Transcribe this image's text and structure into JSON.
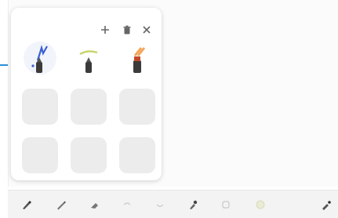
{
  "pen_panel": {
    "add_button_icon": "plus-icon",
    "delete_button_icon": "trash-icon",
    "close_button_icon": "close-icon",
    "favorite_pens": [
      {
        "type": "fountain-pen",
        "stroke_color": "#3b5fd6",
        "selected": true
      },
      {
        "type": "marker",
        "stroke_color": "#c7d36a",
        "selected": false
      },
      {
        "type": "highlighter",
        "stroke_color": "#f3a55a",
        "selected": false
      }
    ],
    "empty_slots": 6
  },
  "toolbar": {
    "tools": [
      {
        "icon": "fountain-pen-icon",
        "active": true
      },
      {
        "icon": "pencil-icon",
        "active": false
      },
      {
        "icon": "eraser-icon",
        "active": false
      },
      {
        "icon": "undo-icon",
        "active": false
      },
      {
        "icon": "redo-icon",
        "active": false
      },
      {
        "icon": "brush-icon",
        "active": false
      },
      {
        "icon": "shape-icon",
        "active": false
      },
      {
        "icon": "color-palette-icon",
        "active": false
      },
      {
        "icon": "settings-pen-icon",
        "active": false
      }
    ]
  },
  "colors": {
    "callout": "#2a8fd8",
    "slot_empty": "#ececec",
    "toolbar_bg": "#f3f3f3"
  }
}
